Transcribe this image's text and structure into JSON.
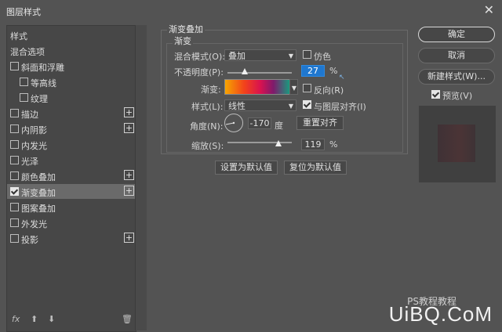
{
  "window": {
    "title": "图层样式",
    "close_glyph": "✕"
  },
  "styles_panel": {
    "header": "样式",
    "items": [
      {
        "label": "混合选项",
        "checkbox": false,
        "checked": false,
        "plus": false
      },
      {
        "label": "斜面和浮雕",
        "checkbox": true,
        "checked": false,
        "plus": false
      },
      {
        "label": "等高线",
        "checkbox": true,
        "checked": false,
        "plus": false,
        "indent": true
      },
      {
        "label": "纹理",
        "checkbox": true,
        "checked": false,
        "plus": false,
        "indent": true
      },
      {
        "label": "描边",
        "checkbox": true,
        "checked": false,
        "plus": true
      },
      {
        "label": "内阴影",
        "checkbox": true,
        "checked": false,
        "plus": true
      },
      {
        "label": "内发光",
        "checkbox": true,
        "checked": false,
        "plus": false
      },
      {
        "label": "光泽",
        "checkbox": true,
        "checked": false,
        "plus": false
      },
      {
        "label": "颜色叠加",
        "checkbox": true,
        "checked": false,
        "plus": true
      },
      {
        "label": "渐变叠加",
        "checkbox": true,
        "checked": true,
        "plus": true,
        "selected": true
      },
      {
        "label": "图案叠加",
        "checkbox": true,
        "checked": false,
        "plus": false
      },
      {
        "label": "外发光",
        "checkbox": true,
        "checked": false,
        "plus": false
      },
      {
        "label": "投影",
        "checkbox": true,
        "checked": false,
        "plus": true
      }
    ],
    "footer": {
      "fx": "fx",
      "up": "⬆",
      "down": "⬇",
      "trash": "🗑"
    }
  },
  "gradient_overlay": {
    "group_title": "渐变叠加",
    "sub_title": "渐变",
    "blend_mode_label": "混合模式(O):",
    "blend_mode_value": "叠加",
    "dither_label": "仿色",
    "opacity_label": "不透明度(P):",
    "opacity_value": "27",
    "opacity_fraction": 0.27,
    "percent": "%",
    "gradient_label": "渐变:",
    "reverse_label": "反向(R)",
    "style_label": "样式(L):",
    "style_value": "线性",
    "align_label": "与图层对齐(I)",
    "align_checked": true,
    "angle_label": "角度(N):",
    "angle_value": "-170",
    "angle_unit": "度",
    "reset_align_label": "重置对齐",
    "scale_label": "缩放(S):",
    "scale_value": "119",
    "scale_fraction": 0.79,
    "set_default_label": "设置为默认值",
    "reset_default_label": "复位为默认值"
  },
  "right_buttons": {
    "ok": "确定",
    "cancel": "取消",
    "new_style": "新建样式(W)...",
    "preview_label": "预览(V)",
    "preview_checked": true
  },
  "watermark": {
    "main": "UiBQ.CoM",
    "sub": "PS教程教程"
  }
}
